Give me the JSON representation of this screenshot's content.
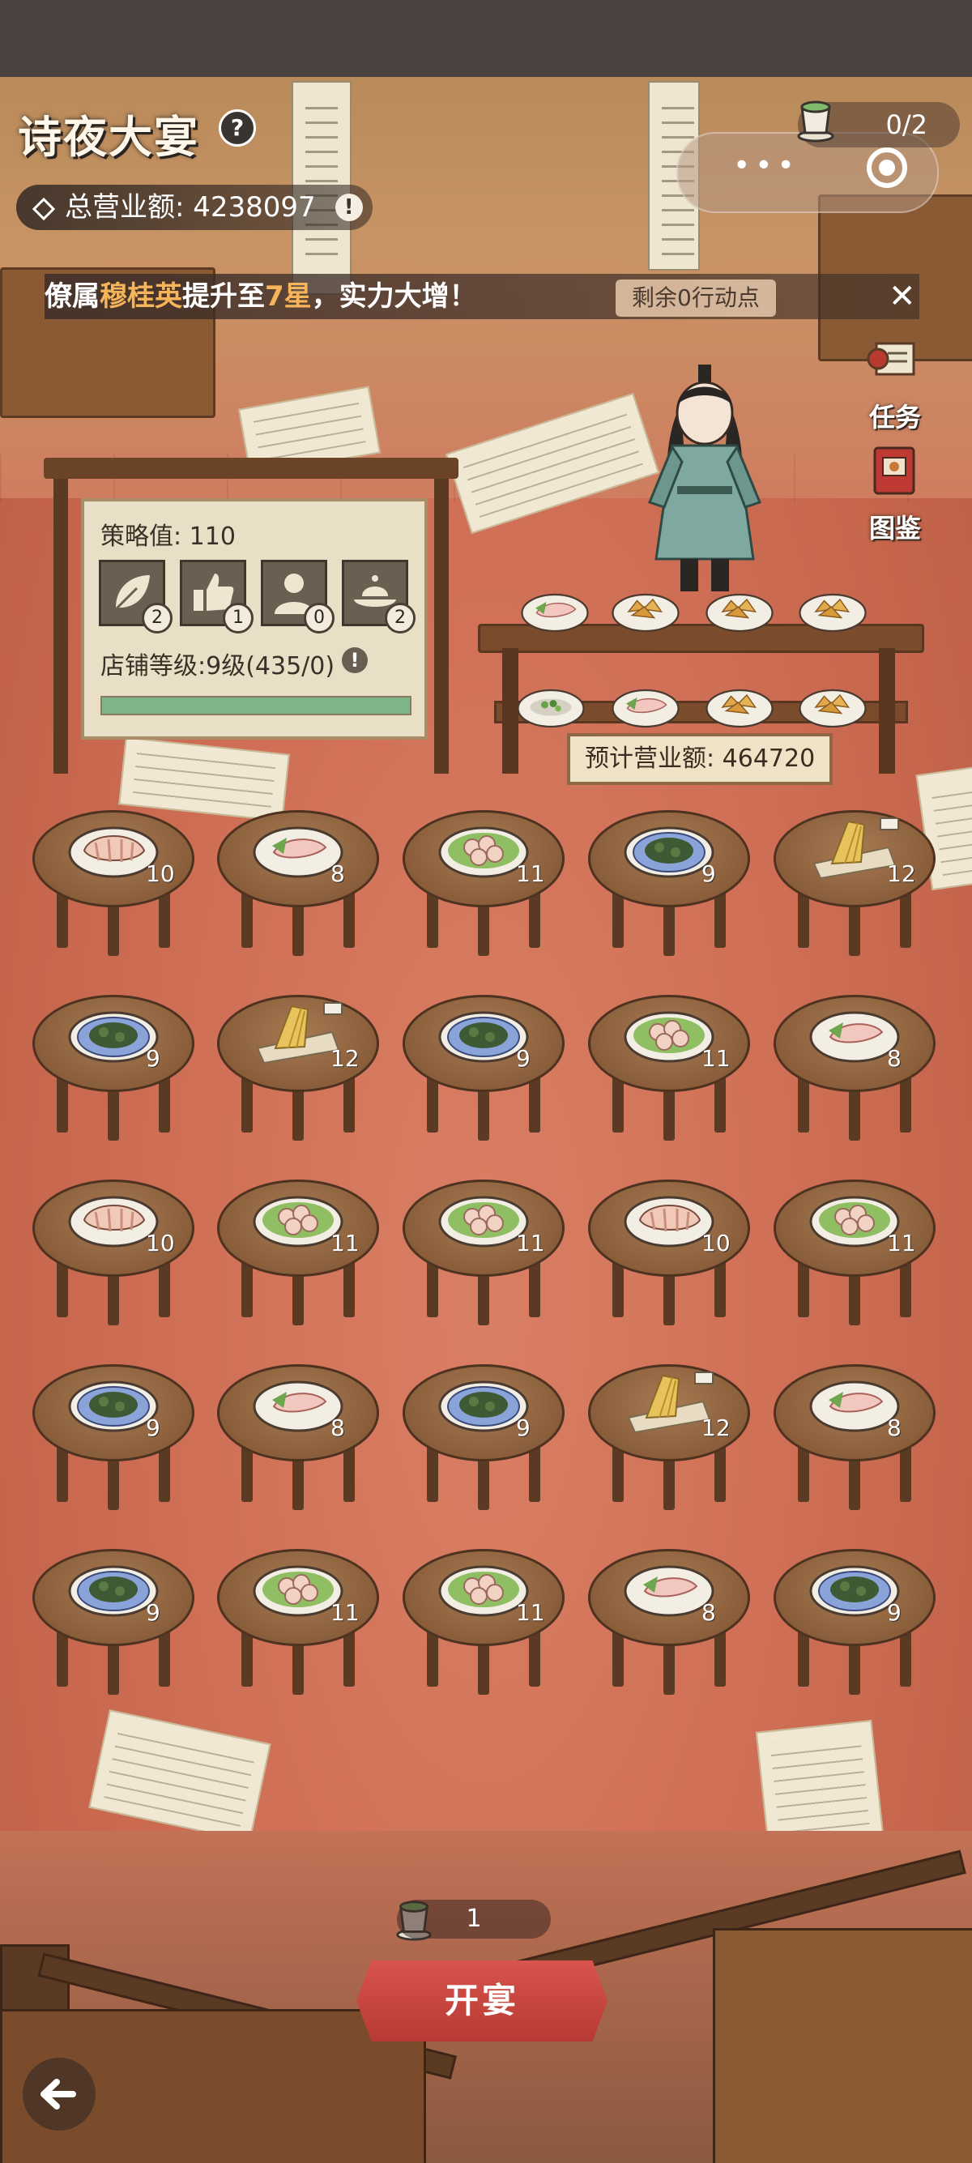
{
  "header": {
    "title": "诗夜大宴",
    "help_glyph": "?",
    "total_revenue_label": "总营业额: 4238097",
    "info_glyph": "!",
    "cup_counter": "0/2",
    "more_glyph": "•••"
  },
  "ticker": {
    "prefix": "僚属",
    "name": "穆桂英",
    "middle": "提升至",
    "star": "7星",
    "suffix": "，实力大增！",
    "remaining": "剩余0行动点",
    "close_glyph": "✕"
  },
  "side_buttons": {
    "tasks": "任务",
    "codex": "图鉴"
  },
  "strategy_board": {
    "strategy_label": "策略值: 110",
    "skills": [
      {
        "name": "leaf-skill",
        "count": "2"
      },
      {
        "name": "thumbs-up-skill",
        "count": "1"
      },
      {
        "name": "person-skill",
        "count": "0"
      },
      {
        "name": "feast-skill",
        "count": "2"
      }
    ],
    "shop_level": "店铺等级:9级(435/0)",
    "info_glyph": "!",
    "progress": 1.0
  },
  "counter": {
    "forecast": "预计营业额: 464720",
    "top_dishes": [
      "sashimi",
      "fried-tofu",
      "fried-tofu",
      "fried-tofu"
    ],
    "bottom_dishes": [
      "herb-salad",
      "sashimi",
      "fried-tofu",
      "fried-tofu"
    ]
  },
  "tables": [
    [
      {
        "dish": "chicken",
        "value": "10"
      },
      {
        "dish": "sashimi",
        "value": "8"
      },
      {
        "dish": "shrimp",
        "value": "11"
      },
      {
        "dish": "crab",
        "value": "9"
      },
      {
        "dish": "bamboo",
        "value": "12"
      }
    ],
    [
      {
        "dish": "crab",
        "value": "9"
      },
      {
        "dish": "bamboo",
        "value": "12"
      },
      {
        "dish": "crab",
        "value": "9"
      },
      {
        "dish": "shrimp",
        "value": "11"
      },
      {
        "dish": "sashimi",
        "value": "8"
      }
    ],
    [
      {
        "dish": "chicken",
        "value": "10"
      },
      {
        "dish": "shrimp",
        "value": "11"
      },
      {
        "dish": "shrimp",
        "value": "11"
      },
      {
        "dish": "chicken",
        "value": "10"
      },
      {
        "dish": "shrimp",
        "value": "11"
      }
    ],
    [
      {
        "dish": "crab",
        "value": "9"
      },
      {
        "dish": "sashimi",
        "value": "8"
      },
      {
        "dish": "crab",
        "value": "9"
      },
      {
        "dish": "bamboo",
        "value": "12"
      },
      {
        "dish": "sashimi",
        "value": "8"
      }
    ],
    [
      {
        "dish": "crab",
        "value": "9"
      },
      {
        "dish": "shrimp",
        "value": "11"
      },
      {
        "dish": "shrimp",
        "value": "11"
      },
      {
        "dish": "sashimi",
        "value": "8"
      },
      {
        "dish": "crab",
        "value": "9"
      }
    ]
  ],
  "footer": {
    "cost": "1",
    "start_label": "开宴"
  },
  "colors": {
    "highlight": "#f6b55a",
    "start_button": "#c8463f",
    "floor": "#cf6f55",
    "progress_fill": "#7eb48a"
  }
}
